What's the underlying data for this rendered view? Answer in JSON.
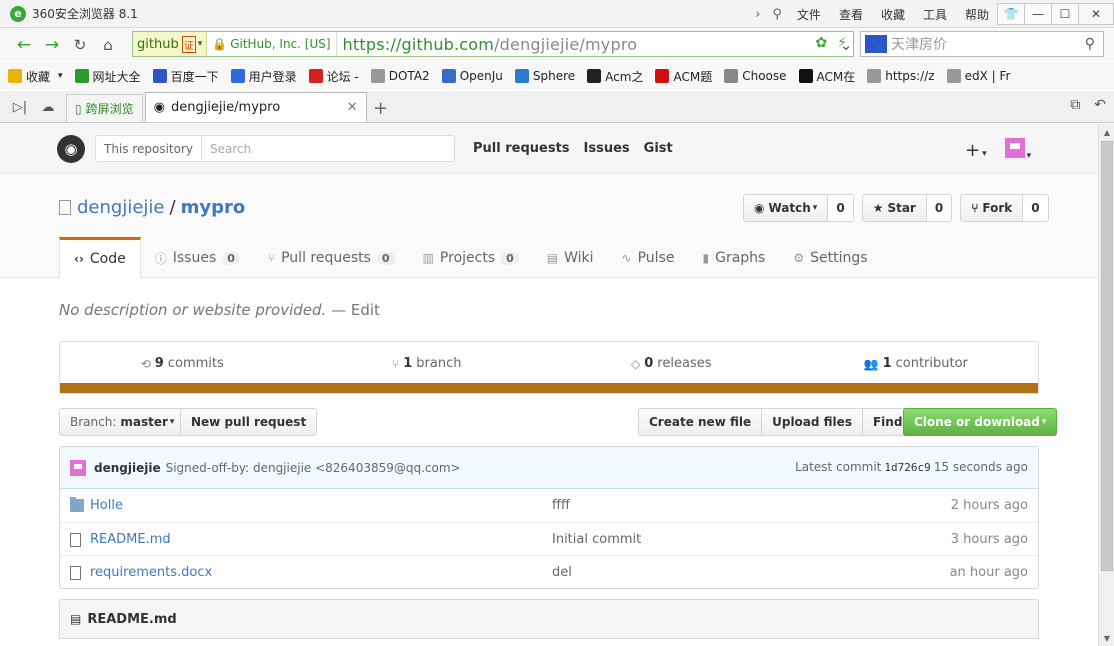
{
  "window": {
    "title": "360安全浏览器 8.1",
    "menus": [
      "文件",
      "查看",
      "收藏",
      "工具",
      "帮助"
    ]
  },
  "address": {
    "site_chip": "github",
    "cert_badge": "证",
    "cert_owner": "GitHub, Inc. [US]",
    "url_host": "https://github.com",
    "url_path": "/dengjiejie/mypro",
    "search_placeholder": "天津房价"
  },
  "bookmarks": [
    {
      "label": "收藏",
      "icon": "star-icon",
      "color": "#e8b400"
    },
    {
      "label": "网址大全",
      "icon": "nav-icon",
      "color": "#2a9a2a"
    },
    {
      "label": "百度一下",
      "icon": "paw-icon",
      "color": "#2d54c8"
    },
    {
      "label": "用户登录",
      "icon": "user-icon",
      "color": "#2d6bd8"
    },
    {
      "label": "论坛 -",
      "icon": "forum-icon",
      "color": "#d02020"
    },
    {
      "label": "DOTA2",
      "icon": "page-icon",
      "color": "#999999"
    },
    {
      "label": "OpenJu",
      "icon": "poj-icon",
      "color": "#3a6ac8"
    },
    {
      "label": "Sphere",
      "icon": "sphere-icon",
      "color": "#2a7ad0"
    },
    {
      "label": "Acm之",
      "icon": "braces-icon",
      "color": "#222222"
    },
    {
      "label": "ACM题",
      "icon": "acm-icon",
      "color": "#d01010"
    },
    {
      "label": "Choose",
      "icon": "choose-icon",
      "color": "#888888"
    },
    {
      "label": "ACM在",
      "icon": "acm-online-icon",
      "color": "#111111"
    },
    {
      "label": "https://z",
      "icon": "page-icon",
      "color": "#999999"
    },
    {
      "label": "edX | Fr",
      "icon": "page-icon",
      "color": "#999999"
    }
  ],
  "tabs": {
    "small_tab": "跨屏浏览",
    "active_tab": "dengjiejie/mypro"
  },
  "github": {
    "search_scope": "This repository",
    "search_placeholder": "Search",
    "nav": [
      "Pull requests",
      "Issues",
      "Gist"
    ],
    "owner": "dengjiejie",
    "repo": "mypro",
    "watch_label": "Watch",
    "watch_count": "0",
    "star_label": "Star",
    "star_count": "0",
    "fork_label": "Fork",
    "fork_count": "0",
    "repo_tabs": [
      {
        "label": "Code",
        "icon": "‹›",
        "count": ""
      },
      {
        "label": "Issues",
        "icon": "ⓘ",
        "count": "0"
      },
      {
        "label": "Pull requests",
        "icon": "⑂",
        "count": "0"
      },
      {
        "label": "Projects",
        "icon": "▥",
        "count": "0"
      },
      {
        "label": "Wiki",
        "icon": "▤",
        "count": ""
      },
      {
        "label": "Pulse",
        "icon": "∿",
        "count": ""
      },
      {
        "label": "Graphs",
        "icon": "▮",
        "count": ""
      },
      {
        "label": "Settings",
        "icon": "⚙",
        "count": ""
      }
    ],
    "description": "No description or website provided.",
    "description_sep": "—",
    "edit_label": "Edit",
    "summary": {
      "commits_num": "9",
      "commits_label": "commits",
      "branch_num": "1",
      "branch_label": "branch",
      "releases_num": "0",
      "releases_label": "releases",
      "contributor_num": "1",
      "contributor_label": "contributor"
    },
    "language_color": "#b07219",
    "branch_prefix": "Branch:",
    "branch_name": "master",
    "new_pr": "New pull request",
    "create_file": "Create new file",
    "upload_files": "Upload files",
    "find_file": "Find file",
    "clone": "Clone or download",
    "commit": {
      "author": "dengjiejie",
      "message": "Signed-off-by: dengjiejie <826403859@qq.com>",
      "latest_label": "Latest commit",
      "sha": "1d726c9",
      "age": "15 seconds ago"
    },
    "files": [
      {
        "name": "Holle",
        "type": "folder",
        "message": "ffff",
        "age": "2 hours ago"
      },
      {
        "name": "README.md",
        "type": "file",
        "message": "Initial commit",
        "age": "3 hours ago"
      },
      {
        "name": "requirements.docx",
        "type": "file",
        "message": "del",
        "age": "an hour ago"
      }
    ],
    "readme_title": "README.md"
  }
}
